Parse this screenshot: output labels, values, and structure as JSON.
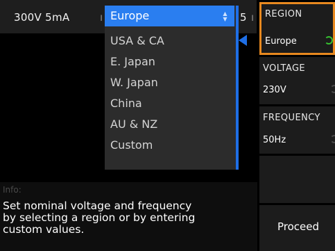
{
  "status_bar": {
    "range_text": "300V 5mA",
    "separator": "ı",
    "tail_digit": "5",
    "tail_separator": "ı"
  },
  "region_dropdown": {
    "selected_index": 0,
    "options": [
      "Europe",
      "USA & CA",
      "E. Japan",
      "W. Japan",
      "China",
      "AU & NZ",
      "Custom"
    ],
    "scroll_glyph": "▲▼"
  },
  "info": {
    "label": "Info:",
    "text_lines": [
      "Set nominal voltage and frequency",
      "by selecting a region or by entering",
      "custom values."
    ]
  },
  "softkeys": {
    "region": {
      "title": "REGION",
      "value": "Europe"
    },
    "voltage": {
      "title": "VOLTAGE",
      "value": "230V"
    },
    "frequency": {
      "title": "FREQUENCY",
      "value": "50Hz"
    },
    "proceed": {
      "label": "Proceed"
    }
  },
  "colors": {
    "accent_orange": "#e8891f",
    "selection_blue": "#2a7ef0",
    "knob_active": "#36c230"
  }
}
